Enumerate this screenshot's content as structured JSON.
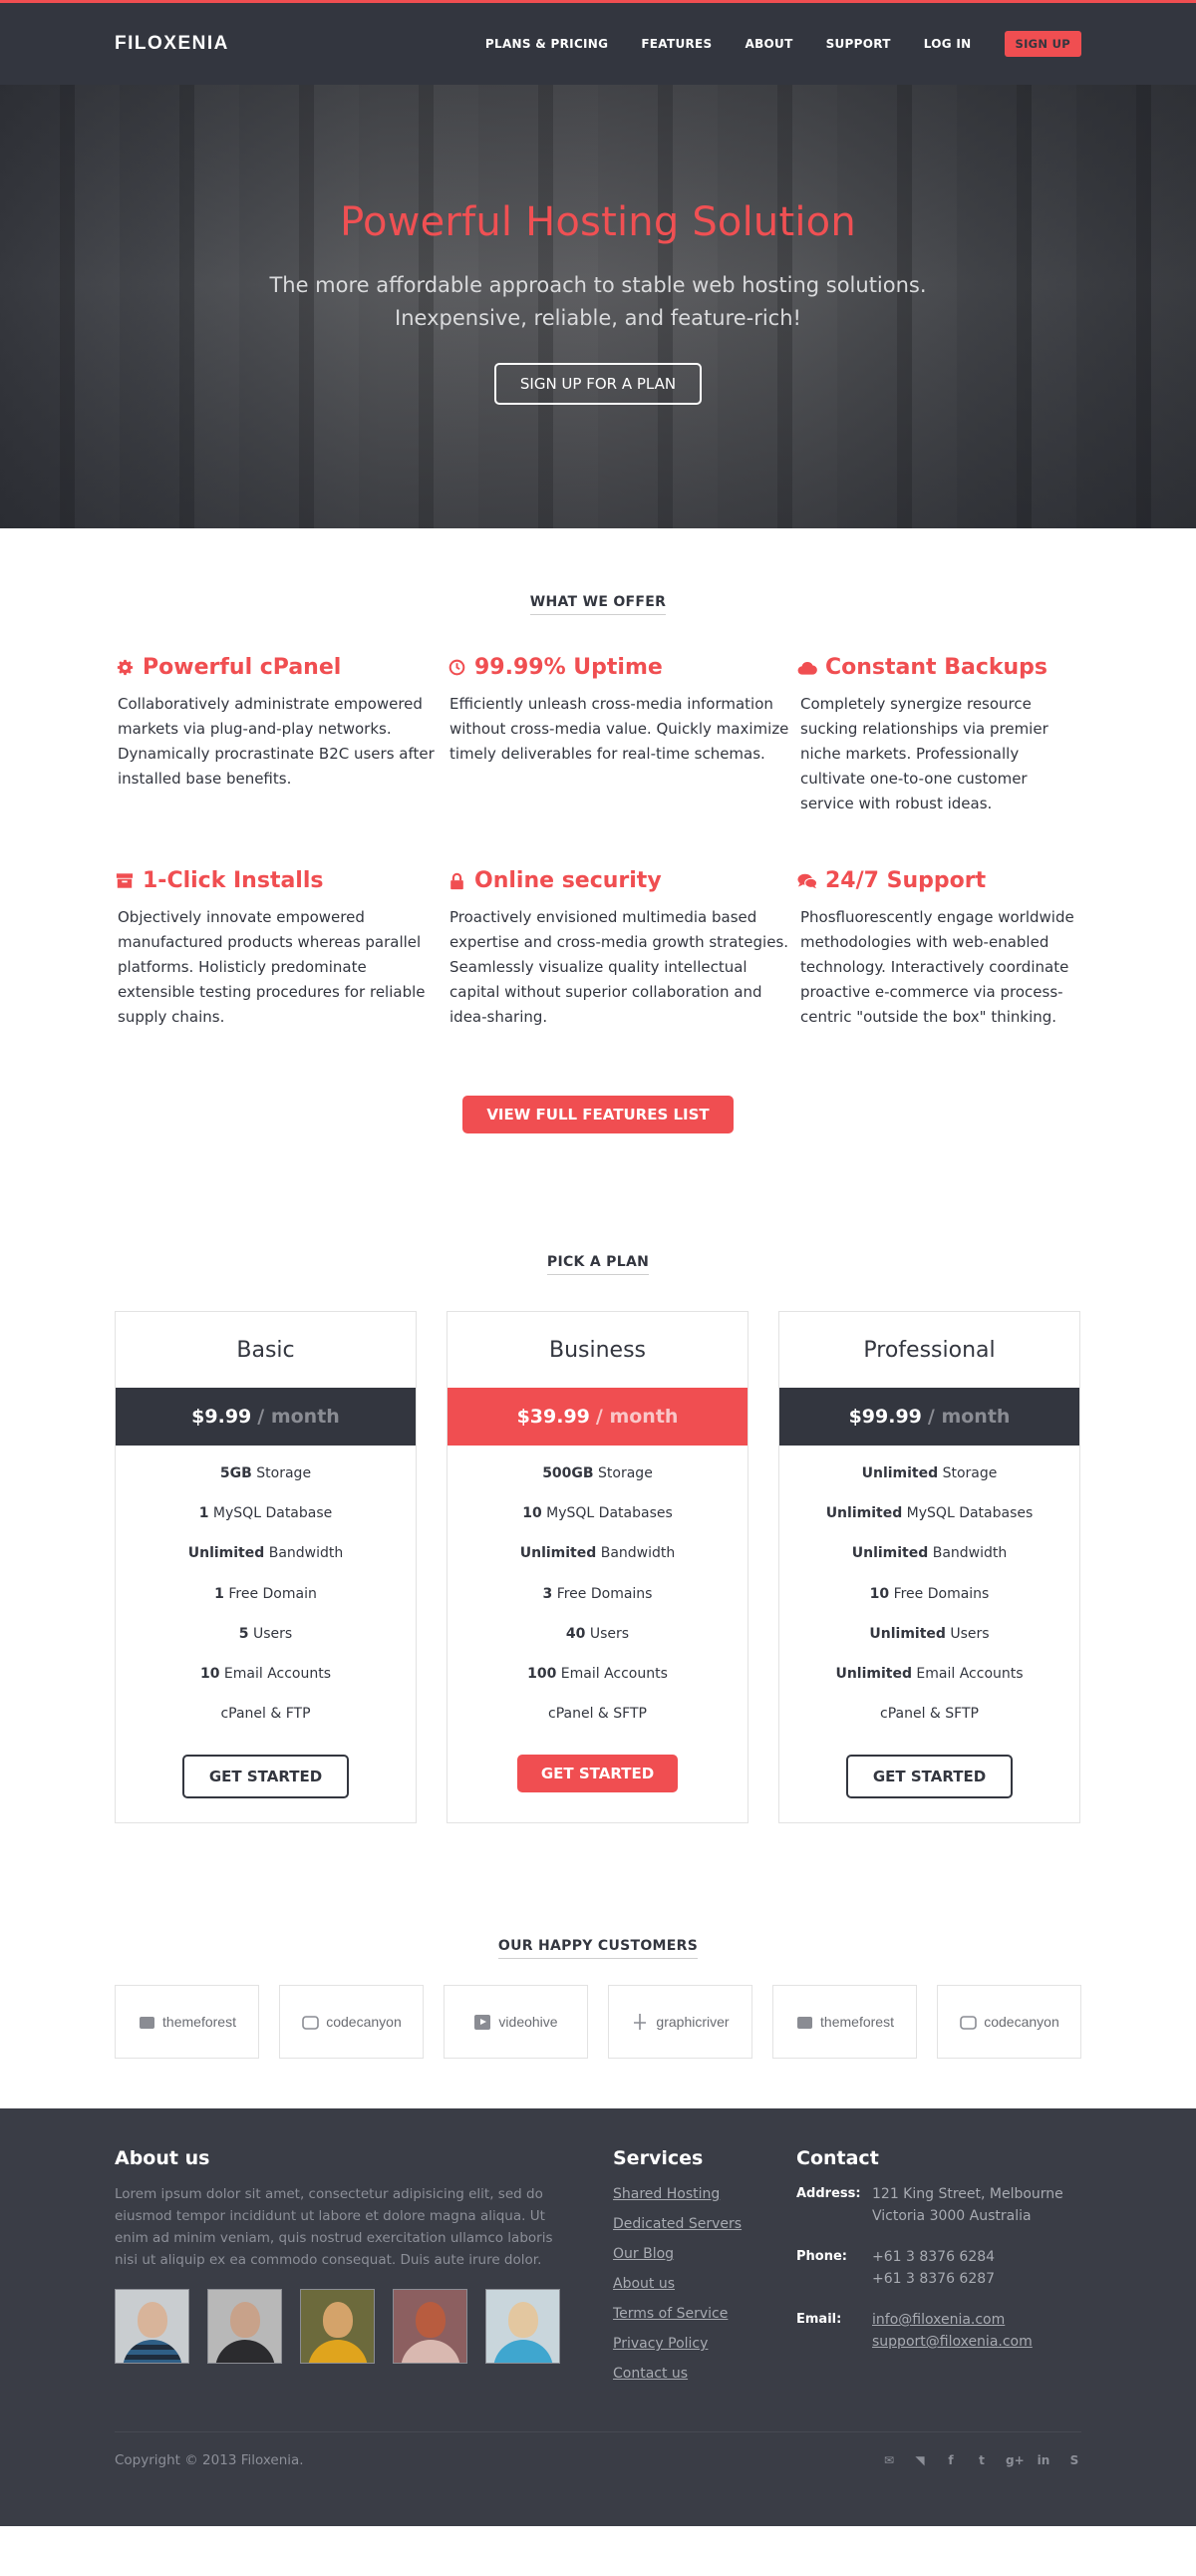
{
  "brand": {
    "logo": "FILOXENIA"
  },
  "colors": {
    "accent": "#f04e51",
    "dark": "#33363f",
    "footer": "#3a3d46"
  },
  "nav": {
    "items": [
      "PLANS & PRICING",
      "FEATURES",
      "ABOUT",
      "SUPPORT",
      "LOG IN"
    ],
    "signup": "SIGN UP"
  },
  "hero": {
    "title": "Powerful Hosting Solution",
    "line1": "The more affordable approach to stable web hosting solutions.",
    "line2": "Inexpensive, reliable, and feature-rich!",
    "cta": "SIGN UP FOR A PLAN"
  },
  "features": {
    "title": "WHAT WE OFFER",
    "items": [
      {
        "icon": "gear-icon",
        "title": "Powerful cPanel",
        "text": "Collaboratively administrate empowered markets via plug-and-play networks. Dynamically procrastinate B2C users after installed base benefits."
      },
      {
        "icon": "clock-icon",
        "title": "99.99% Uptime",
        "text": "Efficiently unleash cross-media information without cross-media value. Quickly maximize timely deliverables for real-time schemas."
      },
      {
        "icon": "cloud-icon",
        "title": "Constant Backups",
        "text": "Completely synergize resource sucking relationships via premier niche markets. Professionally cultivate one-to-one customer service with robust ideas."
      },
      {
        "icon": "archive-icon",
        "title": "1-Click Installs",
        "text": "Objectively innovate empowered manufactured products whereas parallel platforms. Holisticly predominate extensible testing procedures for reliable supply chains."
      },
      {
        "icon": "lock-icon",
        "title": "Online security",
        "text": "Proactively envisioned multimedia based expertise and cross-media growth strategies. Seamlessly visualize quality intellectual capital without superior collaboration and idea-sharing."
      },
      {
        "icon": "chat-icon",
        "title": "24/7 Support",
        "text": "Phosfluorescently engage worldwide methodologies with web-enabled technology. Interactively coordinate proactive e-commerce via process-centric \"outside the box\" thinking."
      }
    ],
    "button": "VIEW FULL FEATURES LIST"
  },
  "plans": {
    "title": "PICK A PLAN",
    "items": [
      {
        "name": "Basic",
        "price": "$9.99",
        "per": "/ month",
        "button": "GET STARTED",
        "rows": [
          [
            "5GB",
            " Storage"
          ],
          [
            "1",
            " MySQL Database"
          ],
          [
            "Unlimited",
            " Bandwidth"
          ],
          [
            "1",
            " Free Domain"
          ],
          [
            "5",
            " Users"
          ],
          [
            "10",
            " Email Accounts"
          ],
          [
            "",
            "cPanel & FTP"
          ]
        ]
      },
      {
        "name": "Business",
        "price": "$39.99",
        "per": "/ month",
        "button": "GET STARTED",
        "rows": [
          [
            "500GB",
            " Storage"
          ],
          [
            "10",
            " MySQL Databases"
          ],
          [
            "Unlimited",
            " Bandwidth"
          ],
          [
            "3",
            " Free Domains"
          ],
          [
            "40",
            " Users"
          ],
          [
            "100",
            " Email Accounts"
          ],
          [
            "",
            "cPanel & SFTP"
          ]
        ]
      },
      {
        "name": "Professional",
        "price": "$99.99",
        "per": "/ month",
        "button": "GET STARTED",
        "rows": [
          [
            "Unlimited",
            " Storage"
          ],
          [
            "Unlimited",
            " MySQL Databases"
          ],
          [
            "Unlimited",
            " Bandwidth"
          ],
          [
            "10",
            " Free Domains"
          ],
          [
            "Unlimited",
            " Users"
          ],
          [
            "Unlimited",
            " Email Accounts"
          ],
          [
            "",
            "cPanel & SFTP"
          ]
        ]
      }
    ]
  },
  "customers": {
    "title": "OUR HAPPY CUSTOMERS",
    "logos": [
      "themeforest",
      "codecanyon",
      "videohive",
      "graphicriver",
      "themeforest",
      "codecanyon"
    ]
  },
  "footer": {
    "about_title": "About us",
    "about_text": "Lorem ipsum dolor sit amet, consectetur adipisicing elit, sed do eiusmod tempor incididunt ut labore et dolore magna aliqua. Ut enim ad minim veniam, quis nostrud exercitation ullamco laboris nisi ut aliquip ex ea commodo consequat. Duis aute irure dolor.",
    "services_title": "Services",
    "services": [
      "Shared Hosting",
      "Dedicated Servers",
      "Our Blog",
      "About us",
      "Terms of Service",
      "Privacy Policy",
      "Contact us"
    ],
    "contact_title": "Contact",
    "address_label": "Address:",
    "address_1": "121 King Street, Melbourne",
    "address_2": "Victoria 3000 Australia",
    "phone_label": "Phone:",
    "phone_1": "+61 3 8376 6284",
    "phone_2": "+61 3 8376 6287",
    "email_label": "Email:",
    "email_1": "info@filoxenia.com",
    "email_2": "support@filoxenia.com",
    "copyright": "Copyright © 2013 Filoxenia.",
    "social": [
      "envelope-icon",
      "rss-icon",
      "facebook-icon",
      "twitter-icon",
      "google-plus-icon",
      "linkedin-icon",
      "skype-icon"
    ]
  }
}
